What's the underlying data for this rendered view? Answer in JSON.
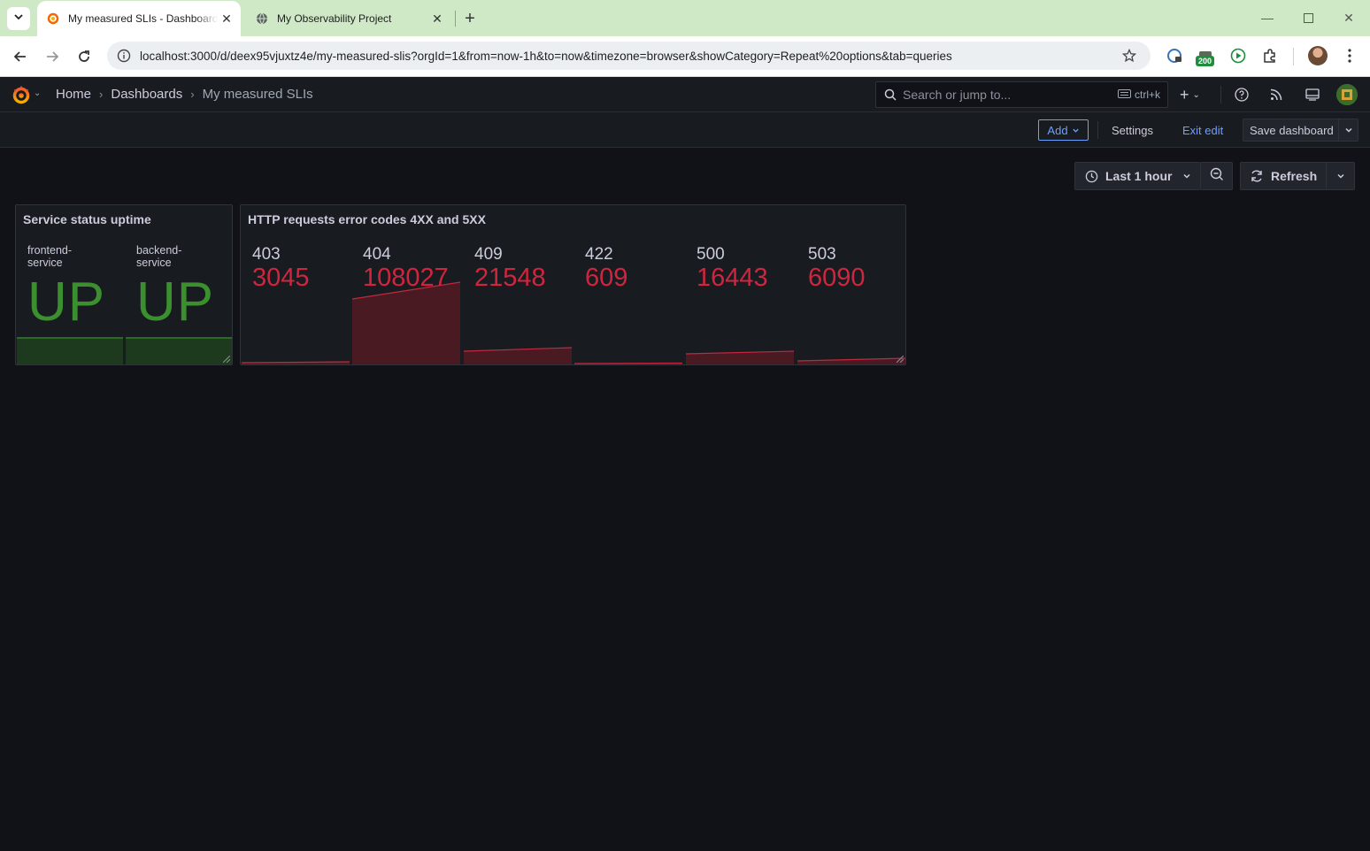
{
  "browser": {
    "tabs": [
      {
        "title": "My measured SLIs - Dashboards - Grafana",
        "active": true
      },
      {
        "title": "My Observability Project",
        "active": false
      }
    ],
    "url": "localhost:3000/d/deex95vjuxtz4e/my-measured-slis?orgId=1&from=now-1h&to=now&timezone=browser&showCategory=Repeat%20options&tab=queries",
    "extension_badge": "200"
  },
  "grafana": {
    "breadcrumb": [
      "Home",
      "Dashboards",
      "My measured SLIs"
    ],
    "search_placeholder": "Search or jump to...",
    "search_shortcut": "ctrl+k",
    "actions": {
      "add": "Add",
      "settings": "Settings",
      "exit_edit": "Exit edit",
      "save": "Save dashboard"
    },
    "time_range": "Last 1 hour",
    "refresh": "Refresh"
  },
  "panels": {
    "status": {
      "title": "Service status uptime",
      "items": [
        {
          "name": "frontend-\nservice",
          "value": "UP"
        },
        {
          "name": "backend-\nservice",
          "value": "UP"
        }
      ]
    },
    "errors": {
      "title": "HTTP requests error codes 4XX and 5XX",
      "items": [
        {
          "code": "403",
          "value": "3045"
        },
        {
          "code": "404",
          "value": "108027"
        },
        {
          "code": "409",
          "value": "21548"
        },
        {
          "code": "422",
          "value": "609"
        },
        {
          "code": "500",
          "value": "16443"
        },
        {
          "code": "503",
          "value": "6090"
        }
      ]
    }
  },
  "colors": {
    "ok_green": "#3b8f2e",
    "error_red": "#d0253e",
    "link_blue": "#6e9fff"
  }
}
